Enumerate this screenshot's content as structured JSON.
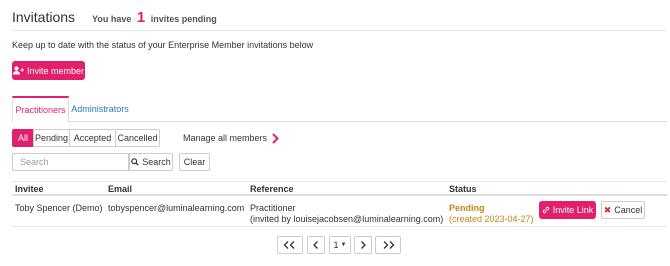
{
  "header": {
    "title": "Invitations",
    "pending_prefix": "You have",
    "pending_count": "1",
    "pending_suffix": "invites pending"
  },
  "intro_text": "Keep up to date with the status of your Enterprise Member invitations below",
  "invite_button": {
    "label": "Invite member",
    "icon": "user-plus-icon"
  },
  "tabs": [
    {
      "label": "Practitioners",
      "active": true
    },
    {
      "label": "Administrators",
      "active": false
    }
  ],
  "filters": [
    {
      "label": "All",
      "active": true
    },
    {
      "label": "Pending",
      "active": false
    },
    {
      "label": "Accepted",
      "active": false
    },
    {
      "label": "Cancelled",
      "active": false
    }
  ],
  "manage_link": {
    "label": "Manage all members",
    "icon": "chevron-right-icon"
  },
  "search": {
    "placeholder": "Search",
    "button_label": "Search",
    "clear_label": "Clear"
  },
  "table": {
    "columns": [
      "Invitee",
      "Email",
      "Reference",
      "Status"
    ],
    "rows": [
      {
        "invitee": "Toby Spencer (Demo)",
        "email": "tobyspencer@luminalearning.com",
        "reference_line1": "Practitioner",
        "reference_line2": "(invited by louisejacobsen@luminalearning.com)",
        "status": "Pending",
        "status_detail": "(created 2023-04-27)",
        "invite_link_label": "Invite Link",
        "cancel_label": "Cancel"
      }
    ]
  },
  "pagination": {
    "current_page": "1"
  },
  "colors": {
    "accent": "#e11f6a",
    "link": "#2a7ab0",
    "pending": "#c8851c",
    "cancel_x": "#d9302c"
  }
}
